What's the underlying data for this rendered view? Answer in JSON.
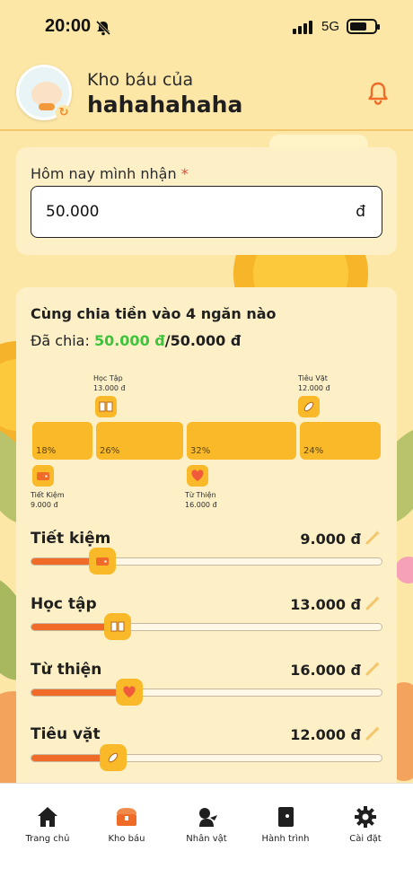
{
  "status_bar": {
    "time": "20:00",
    "network": "5G"
  },
  "header": {
    "subtitle": "Kho báu của",
    "title": "hahahahaha"
  },
  "income": {
    "label": "Hôm nay mình nhận",
    "required_mark": "*",
    "value": "50.000",
    "unit": "đ"
  },
  "split": {
    "title": "Cùng chia tiền vào 4 ngăn nào",
    "status_prefix": "Đã chia: ",
    "allocated": "50.000 đ",
    "total": "/50.000 đ",
    "segments": [
      {
        "percent": "18%",
        "value": 18
      },
      {
        "percent": "26%",
        "value": 26
      },
      {
        "percent": "32%",
        "value": 32
      },
      {
        "percent": "24%",
        "value": 24
      }
    ],
    "labels": [
      {
        "name": "Học Tập",
        "amount": "13.000 đ"
      },
      {
        "name": "Tiêu Vặt",
        "amount": "12.000 đ"
      },
      {
        "name": "Tiết Kiệm",
        "amount": "9.000 đ"
      },
      {
        "name": "Từ Thiện",
        "amount": "16.000 đ"
      }
    ],
    "rows": [
      {
        "name": "Tiết kiệm",
        "amount": "9.000 đ",
        "fill": 0.18
      },
      {
        "name": "Học tập",
        "amount": "13.000 đ",
        "fill": 0.26
      },
      {
        "name": "Từ thiện",
        "amount": "16.000 đ",
        "fill": 0.32
      },
      {
        "name": "Tiêu vặt",
        "amount": "12.000 đ",
        "fill": 0.24
      }
    ]
  },
  "nav": {
    "items": [
      {
        "label": "Trang chủ",
        "icon": "home-icon",
        "active": false
      },
      {
        "label": "Kho báu",
        "icon": "treasure-chest-icon",
        "active": true
      },
      {
        "label": "Nhân vật",
        "icon": "character-icon",
        "active": false
      },
      {
        "label": "Hành trình",
        "icon": "journey-book-icon",
        "active": false
      },
      {
        "label": "Cài đặt",
        "icon": "gear-icon",
        "active": false
      }
    ]
  },
  "colors": {
    "accent": "#f9b928",
    "slider_fill": "#ef6b27",
    "allocated_green": "#3cc43c",
    "active_nav": "#ef6b27"
  }
}
